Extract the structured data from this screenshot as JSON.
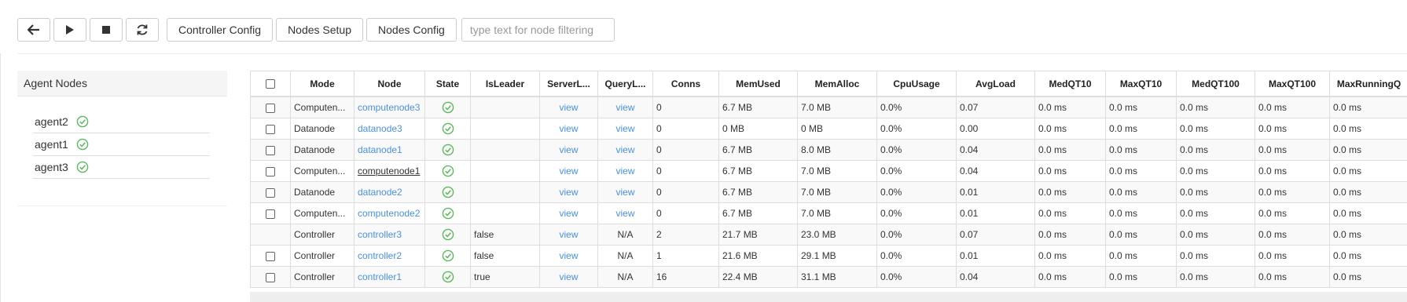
{
  "toolbar": {
    "back_icon": "arrow-left-icon",
    "play_icon": "play-icon",
    "stop_icon": "stop-icon",
    "refresh_icon": "refresh-icon",
    "controller_config": "Controller Config",
    "nodes_setup": "Nodes Setup",
    "nodes_config": "Nodes Config",
    "filter_placeholder": "type text for node filtering"
  },
  "agents": {
    "title": "Agent Nodes",
    "items": [
      "agent2",
      "agent1",
      "agent3"
    ]
  },
  "table": {
    "headers": [
      "Mode",
      "Node",
      "State",
      "IsLeader",
      "ServerL...",
      "QueryL...",
      "Conns",
      "MemUsed",
      "MemAlloc",
      "CpuUsage",
      "AvgLoad",
      "MedQT10",
      "MaxQT10",
      "MedQT100",
      "MaxQT100",
      "MaxRunningQ"
    ],
    "rows": [
      [
        "Computen...",
        "computenode3",
        "",
        "",
        "view",
        "view",
        "0",
        "6.7 MB",
        "7.0 MB",
        "0.0%",
        "0.07",
        "0.0 ms",
        "0.0 ms",
        "0.0 ms",
        "0.0 ms",
        "0.0 ms"
      ],
      [
        "Datanode",
        "datanode3",
        "",
        "",
        "view",
        "view",
        "0",
        "0 MB",
        "0 MB",
        "0.0%",
        "0.00",
        "0.0 ms",
        "0.0 ms",
        "0.0 ms",
        "0.0 ms",
        "0.0 ms"
      ],
      [
        "Datanode",
        "datanode1",
        "",
        "",
        "view",
        "view",
        "0",
        "6.7 MB",
        "8.0 MB",
        "0.0%",
        "0.04",
        "0.0 ms",
        "0.0 ms",
        "0.0 ms",
        "0.0 ms",
        "0.0 ms"
      ],
      [
        "Computen...",
        "computenode1",
        "",
        "",
        "view",
        "view",
        "0",
        "6.7 MB",
        "7.0 MB",
        "0.0%",
        "0.04",
        "0.0 ms",
        "0.0 ms",
        "0.0 ms",
        "0.0 ms",
        "0.0 ms"
      ],
      [
        "Datanode",
        "datanode2",
        "",
        "",
        "view",
        "view",
        "0",
        "6.7 MB",
        "7.0 MB",
        "0.0%",
        "0.01",
        "0.0 ms",
        "0.0 ms",
        "0.0 ms",
        "0.0 ms",
        "0.0 ms"
      ],
      [
        "Computen...",
        "computenode2",
        "",
        "",
        "view",
        "view",
        "0",
        "6.7 MB",
        "7.0 MB",
        "0.0%",
        "0.01",
        "0.0 ms",
        "0.0 ms",
        "0.0 ms",
        "0.0 ms",
        "0.0 ms"
      ],
      [
        "Controller",
        "controller3",
        "",
        "false",
        "view",
        "N/A",
        "2",
        "21.7 MB",
        "23.0 MB",
        "0.0%",
        "0.07",
        "0.0 ms",
        "0.0 ms",
        "0.0 ms",
        "0.0 ms",
        "0.0 ms"
      ],
      [
        "Controller",
        "controller2",
        "",
        "false",
        "view",
        "N/A",
        "1",
        "21.6 MB",
        "29.1 MB",
        "0.0%",
        "0.01",
        "0.0 ms",
        "0.0 ms",
        "0.0 ms",
        "0.0 ms",
        "0.0 ms"
      ],
      [
        "Controller",
        "controller1",
        "",
        "true",
        "view",
        "N/A",
        "16",
        "22.4 MB",
        "31.1 MB",
        "0.0%",
        "0.04",
        "0.0 ms",
        "0.0 ms",
        "0.0 ms",
        "0.0 ms",
        "0.0 ms"
      ]
    ],
    "row_checkbox": [
      true,
      true,
      true,
      true,
      true,
      true,
      false,
      true,
      true
    ],
    "hover_row": 3
  },
  "colors": {
    "link": "#4a90e2",
    "ok_green": "#5cb85c"
  }
}
